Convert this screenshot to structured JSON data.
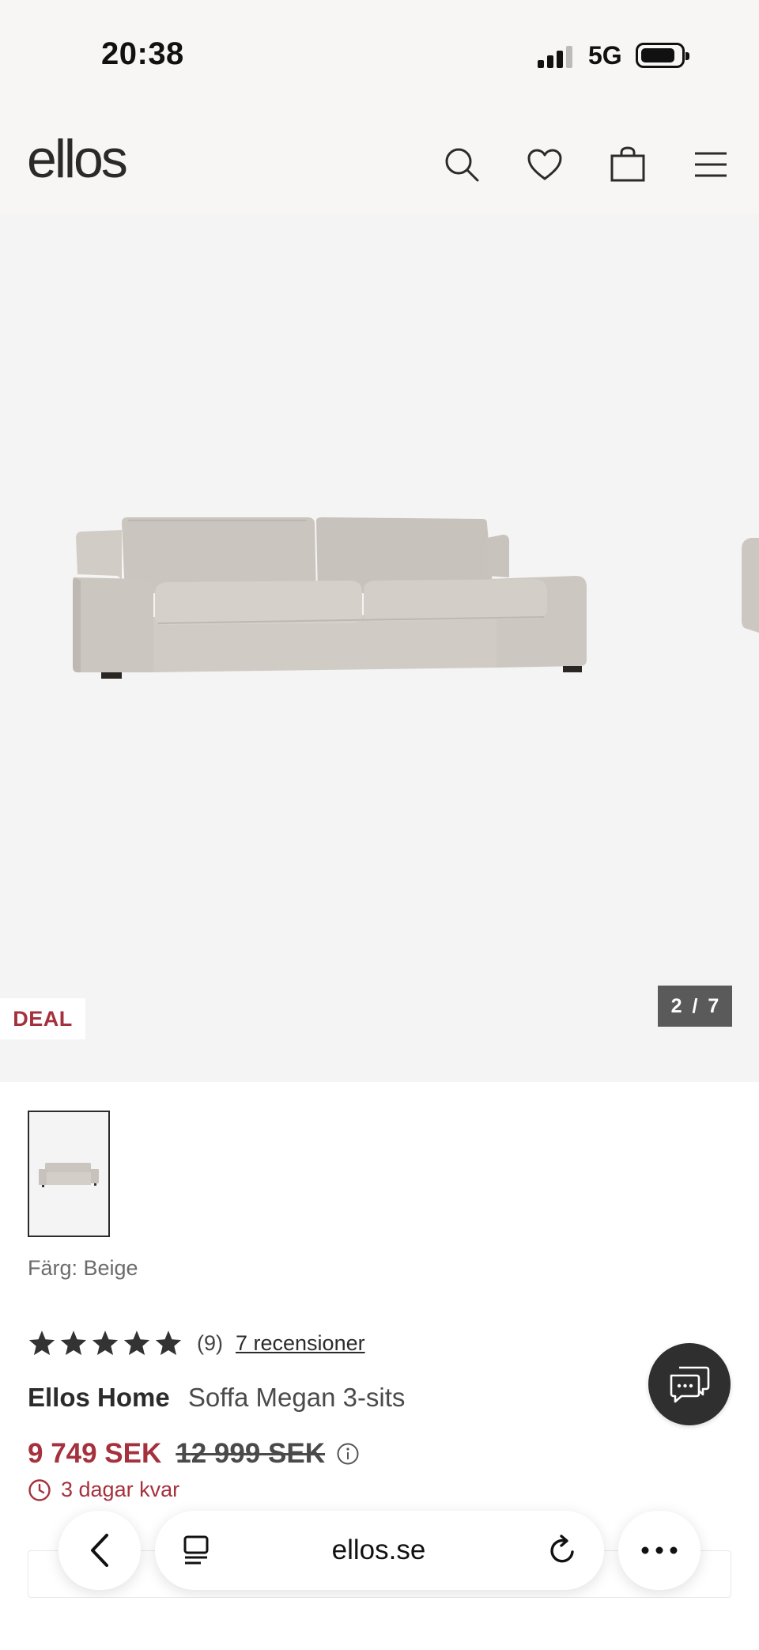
{
  "status_bar": {
    "time": "20:38",
    "network": "5G"
  },
  "header": {
    "logo": "ellos",
    "icons": [
      "search-icon",
      "heart-icon",
      "bag-icon",
      "menu-icon"
    ]
  },
  "gallery": {
    "badge": "DEAL",
    "counter": "2 / 7"
  },
  "product": {
    "color_label": "Färg: Beige",
    "rating": {
      "stars": 5,
      "count": "(9)",
      "reviews_link": "7 recensioner"
    },
    "brand": "Ellos Home",
    "name": "Soffa Megan 3-sits",
    "price_now": "9 749 SEK",
    "price_old": "12 999 SEK",
    "time_left": "3 dagar kvar"
  },
  "browser": {
    "url": "ellos.se"
  },
  "colors": {
    "accent_red": "#a5313c",
    "header_bg": "#f7f6f4",
    "gallery_bg": "#f4f4f5",
    "sofa_beige": "#cfc9c3",
    "chat_bg": "#2f2f2f"
  }
}
